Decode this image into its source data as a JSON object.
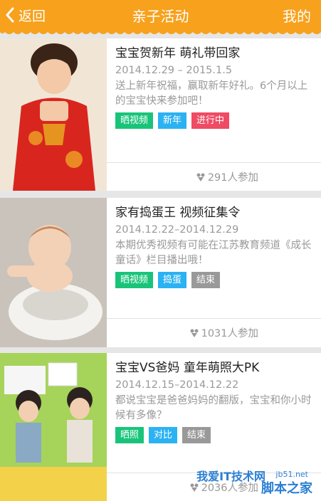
{
  "header": {
    "back_label": "返回",
    "title": "亲子活动",
    "mine_label": "我的",
    "bg_color": "#f7a11c"
  },
  "activities": [
    {
      "title": "宝宝贺新年 萌礼带回家",
      "date": "2014.12.29 – 2015.1.5",
      "desc": "送上新年祝福，赢取新年好礼。6个月以上的宝宝快来参加吧！",
      "tags": [
        {
          "label": "晒视频",
          "color": "green"
        },
        {
          "label": "新年",
          "color": "blue"
        },
        {
          "label": "进行中",
          "color": "red"
        }
      ],
      "participants": "291人参加"
    },
    {
      "title": "家有捣蛋王 视频征集令",
      "date": "2014.12.22–2014.12.29",
      "desc": "本期优秀视频有可能在江苏教育频道《成长童话》栏目播出哦！",
      "tags": [
        {
          "label": "晒视频",
          "color": "green"
        },
        {
          "label": "捣蛋",
          "color": "blue"
        },
        {
          "label": "结束",
          "color": "gray"
        }
      ],
      "participants": "1031人参加"
    },
    {
      "title": "宝宝VS爸妈 童年萌照大PK",
      "date": "2014.12.15–2014.12.22",
      "desc": "都说宝宝是爸爸妈妈的翻版，宝宝和你小时候有多像？",
      "tags": [
        {
          "label": "晒照",
          "color": "green"
        },
        {
          "label": "对比",
          "color": "blue"
        },
        {
          "label": "结束",
          "color": "gray"
        }
      ],
      "participants": "2036人参加"
    }
  ],
  "watermark": {
    "line1": "我爱IT技术网",
    "line2": "jb51.net",
    "line3": "脚本之家"
  },
  "icons": {
    "back": "chevron-left-icon",
    "participants": "people-icon"
  }
}
